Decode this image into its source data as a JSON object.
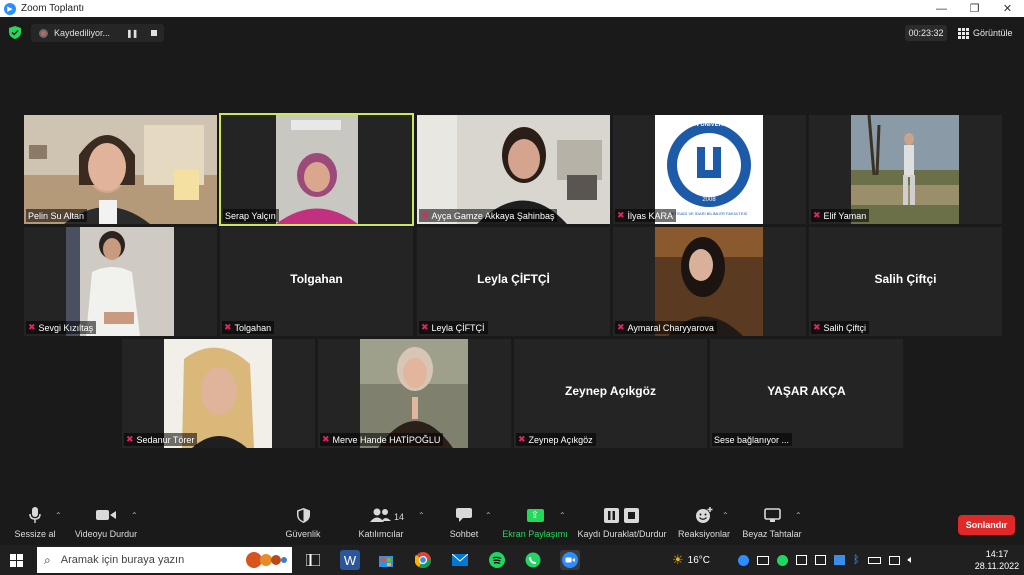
{
  "window": {
    "title": "Zoom Toplantı",
    "minimize": "—",
    "restore": "❐",
    "close": "✕"
  },
  "topbar": {
    "recording_text": "Kaydediliyor...",
    "timer": "00:23:32",
    "view_label": "Görüntüle"
  },
  "participants": [
    {
      "name": "Pelin Su Altan",
      "muted": false,
      "video": true
    },
    {
      "name": "Serap Yalçın",
      "muted": false,
      "video": true,
      "active": true
    },
    {
      "name": "Ayça Gamze Akkaya Şahinbaş",
      "muted": true,
      "video": true
    },
    {
      "name": "İlyas KARA",
      "muted": true,
      "video": true
    },
    {
      "name": "Elif Yaman",
      "muted": true,
      "video": true
    },
    {
      "name": "Sevgi Kızıltaş",
      "muted": true,
      "video": true
    },
    {
      "name": "Tolgahan",
      "muted": true,
      "video": false,
      "display_name": "Tolgahan"
    },
    {
      "name": "Leyla ÇİFTÇİ",
      "muted": true,
      "video": false,
      "display_name": "Leyla ÇİFTÇİ"
    },
    {
      "name": "Aymaral Charyyarova",
      "muted": true,
      "video": true
    },
    {
      "name": "Salih  Çiftçi",
      "muted": true,
      "video": false,
      "display_name": "Salih  Çiftçi"
    },
    {
      "name": "Sedanur Törer",
      "muted": true,
      "video": true
    },
    {
      "name": "Merve Hande HATİPOĞLU",
      "muted": true,
      "video": true
    },
    {
      "name": "Zeynep Açıkgöz",
      "muted": true,
      "video": false,
      "display_name": "Zeynep Açıkgöz"
    },
    {
      "name": "Sese bağlanıyor ...",
      "muted": false,
      "video": false,
      "display_name": "YAŞAR AKÇA"
    }
  ],
  "logo_tile": {
    "top_text": "BARTIN ÜNİVERSİTESİ",
    "year": "2008",
    "bottom_text": "İKTİSADİ VE İDARİ BİLİMLER FAKÜLTESİ"
  },
  "toolbar": {
    "mute_label": "Sessize al",
    "video_label": "Videoyu Durdur",
    "security_label": "Güvenlik",
    "participants_label": "Katılımcılar",
    "participants_count": "14",
    "chat_label": "Sohbet",
    "share_label": "Ekran Paylaşımı",
    "record_label": "Kaydı Duraklat/Durdur",
    "reactions_label": "Reaksiyonlar",
    "whiteboard_label": "Beyaz Tahtalar",
    "end_label": "Sonlandır"
  },
  "taskbar": {
    "search_placeholder": "Aramak için buraya yazın",
    "weather": "16°C",
    "time": "14:17",
    "date": "28.11.2022"
  },
  "colors": {
    "active_speaker_border": "#c9e85a",
    "share_green": "#23d959",
    "end_red": "#e02828",
    "mute_red": "#e0245e",
    "zoom_blue": "#2d8cff"
  }
}
